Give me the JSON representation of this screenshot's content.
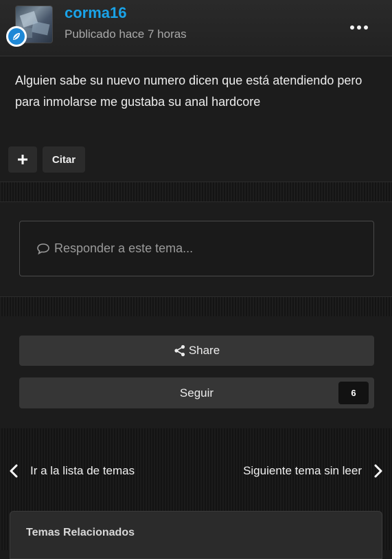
{
  "post": {
    "username": "corma16",
    "posted": "Publicado hace 7 horas",
    "body": "Alguien sabe su nuevo numero dicen que está atendiendo pero para inmolarse me gustaba su anal hardcore",
    "plus_label": "+",
    "quote_label": "Citar"
  },
  "reply": {
    "placeholder": "Responder a este tema..."
  },
  "actions": {
    "share_label": "Share",
    "follow_label": "Seguir",
    "follow_count": "6"
  },
  "navigation": {
    "prev_label": "Ir a la lista de temas",
    "next_label": "Siguiente tema sin leer"
  },
  "related": {
    "title": "Temas Relacionados"
  },
  "colors": {
    "username": "#1aa3e8",
    "badge": "#1e88d6",
    "background": "#1c1c1c"
  }
}
